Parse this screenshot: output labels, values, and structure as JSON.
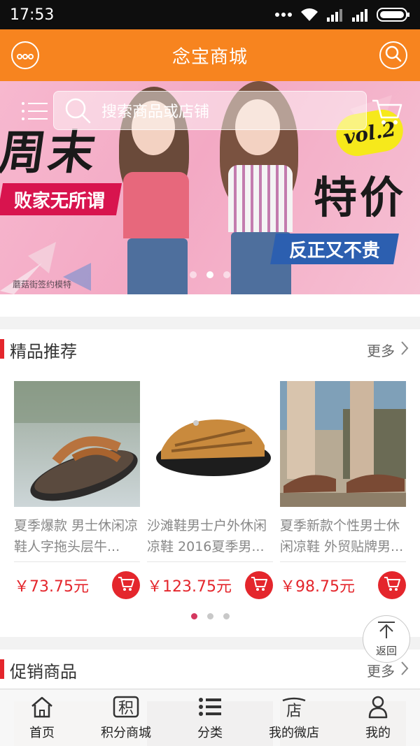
{
  "status_bar": {
    "time": "17:53"
  },
  "header": {
    "title": "念宝商城"
  },
  "search": {
    "placeholder": "搜索商品或店铺"
  },
  "banner": {
    "title_left": "周末",
    "subtitle_left": "败家无所谓",
    "title_right": "特价",
    "badge": "vol.2",
    "subtitle_right": "反正又不贵",
    "caption": "蘑菇街签约模特",
    "dots": 3,
    "active_dot": 1
  },
  "recommend": {
    "title": "精品推荐",
    "more": "更多",
    "products": [
      {
        "name": "夏季爆款 男士休闲凉鞋人字拖头层牛...",
        "price": "￥73.75元"
      },
      {
        "name": "沙滩鞋男士户外休闲凉鞋 2016夏季男...",
        "price": "￥123.75元"
      },
      {
        "name": "夏季新款个性男士休闲凉鞋 外贸贴牌男...",
        "price": "￥98.75元"
      }
    ],
    "dots": 3,
    "active_dot": 0
  },
  "promo": {
    "title": "促销商品",
    "more": "更多"
  },
  "back_to_top": {
    "label": "返回"
  },
  "bottom_nav": {
    "items": [
      {
        "label": "首页",
        "icon": "home-icon"
      },
      {
        "label": "积分商城",
        "icon": "points-icon"
      },
      {
        "label": "分类",
        "icon": "list-icon"
      },
      {
        "label": "我的微店",
        "icon": "store-icon"
      },
      {
        "label": "我的",
        "icon": "user-icon"
      }
    ]
  },
  "colors": {
    "accent": "#f7841f",
    "price": "#e4262c",
    "section_bar": "#e4262c"
  }
}
